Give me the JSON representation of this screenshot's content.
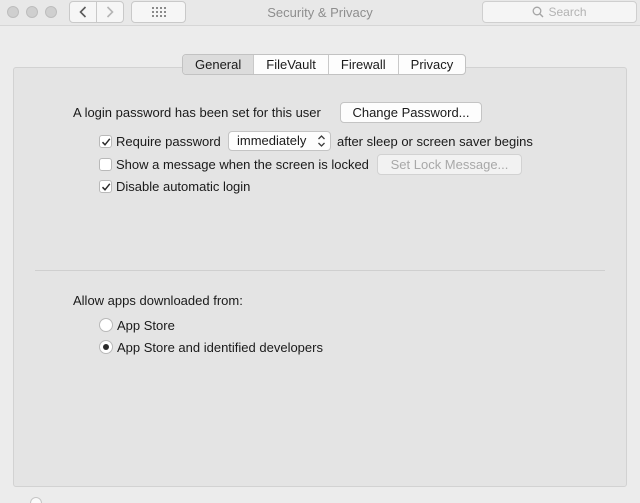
{
  "window": {
    "title": "Security & Privacy",
    "search_placeholder": "Search"
  },
  "tabs": [
    {
      "label": "General",
      "active": true
    },
    {
      "label": "FileVault",
      "active": false
    },
    {
      "label": "Firewall",
      "active": false
    },
    {
      "label": "Privacy",
      "active": false
    }
  ],
  "login": {
    "status_text": "A login password has been set for this user",
    "change_password_label": "Change Password..."
  },
  "require_password": {
    "checked": true,
    "label": "Require password",
    "selected_option": "immediately",
    "suffix": "after sleep or screen saver begins"
  },
  "show_message": {
    "checked": false,
    "label": "Show a message when the screen is locked",
    "button_label": "Set Lock Message..."
  },
  "disable_auto_login": {
    "checked": true,
    "label": "Disable automatic login"
  },
  "allow_apps": {
    "heading": "Allow apps downloaded from:",
    "options": [
      {
        "label": "App Store",
        "selected": false
      },
      {
        "label": "App Store and identified developers",
        "selected": true
      }
    ]
  }
}
